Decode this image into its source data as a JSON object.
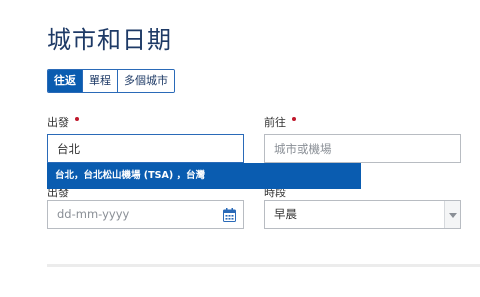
{
  "page": {
    "title": "城市和日期"
  },
  "trip_type": {
    "tabs": [
      {
        "label": "往返",
        "active": true
      },
      {
        "label": "單程",
        "active": false
      },
      {
        "label": "多個城市",
        "active": false
      }
    ]
  },
  "origin": {
    "label": "出發",
    "value": "台北",
    "required": true
  },
  "destination": {
    "label": "前往",
    "placeholder": "城市或機場",
    "required": true
  },
  "autocomplete": {
    "suggestion": "台北，台北松山機場 (TSA) ，台灣"
  },
  "depart_date": {
    "label": "出發",
    "placeholder": "dd-mm-yyyy",
    "icon": "calendar-icon"
  },
  "depart_time": {
    "label": "時段",
    "value": "早晨",
    "icon": "chevron-down-icon"
  },
  "colors": {
    "title": "#1e3a66",
    "accent": "#0a5cb0",
    "required": "#c0182c",
    "border": "#b8bcc2"
  }
}
